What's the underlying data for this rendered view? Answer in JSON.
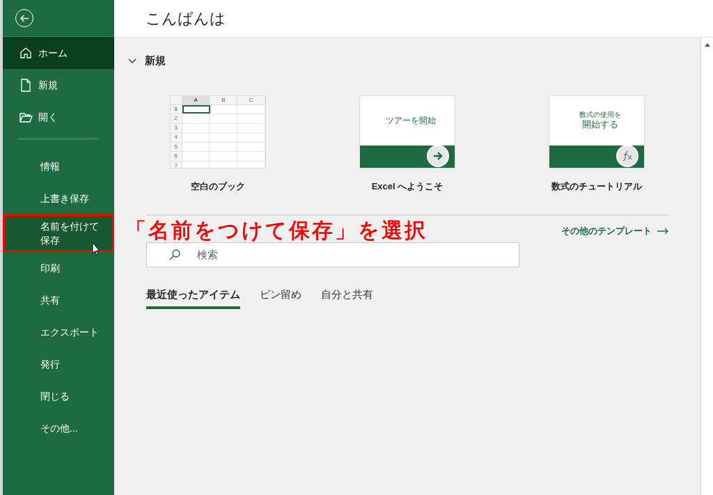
{
  "sidebar": {
    "primary": [
      {
        "kind": "home",
        "label": "ホーム",
        "selected": true,
        "annotated": false
      },
      {
        "kind": "new",
        "label": "新規",
        "selected": false,
        "annotated": false
      },
      {
        "kind": "open",
        "label": "開く",
        "selected": false,
        "annotated": false
      }
    ],
    "secondary": [
      {
        "kind": "text",
        "label": "情報",
        "selected": false,
        "annotated": false
      },
      {
        "kind": "text",
        "label": "上書き保存",
        "selected": false,
        "annotated": false
      },
      {
        "kind": "text",
        "label": "名前を付けて保存",
        "selected": false,
        "annotated": true
      },
      {
        "kind": "text",
        "label": "印刷",
        "selected": false,
        "annotated": false
      },
      {
        "kind": "text",
        "label": "共有",
        "selected": false,
        "annotated": false
      },
      {
        "kind": "text",
        "label": "エクスポート",
        "selected": false,
        "annotated": false
      },
      {
        "kind": "text",
        "label": "発行",
        "selected": false,
        "annotated": false
      },
      {
        "kind": "text",
        "label": "閉じる",
        "selected": false,
        "annotated": false
      },
      {
        "kind": "text",
        "label": "その他...",
        "selected": false,
        "annotated": false
      }
    ]
  },
  "header": {
    "greeting": "こんばんは"
  },
  "new_section": {
    "title": "新規",
    "expanded": true,
    "templates": [
      {
        "kind": "blank",
        "label": "空白のブック",
        "columns": [
          "A",
          "B",
          "C"
        ],
        "rows": [
          "1",
          "2",
          "3",
          "4",
          "5",
          "6",
          "7"
        ]
      },
      {
        "kind": "tour",
        "label": "Excel へようこそ",
        "caption": "ツアーを開始"
      },
      {
        "kind": "formula",
        "label": "数式のチュートリアル",
        "caption_small": "数式の使用を",
        "caption": "開始する"
      }
    ],
    "more_link": "その他のテンプレート"
  },
  "search": {
    "placeholder": "検索"
  },
  "tabs": [
    {
      "label": "最近使ったアイテム",
      "selected": true
    },
    {
      "label": "ピン留め",
      "selected": false
    },
    {
      "label": "自分と共有",
      "selected": false
    }
  ],
  "annotation": {
    "text": "「名前をつけて保存」を選択"
  }
}
